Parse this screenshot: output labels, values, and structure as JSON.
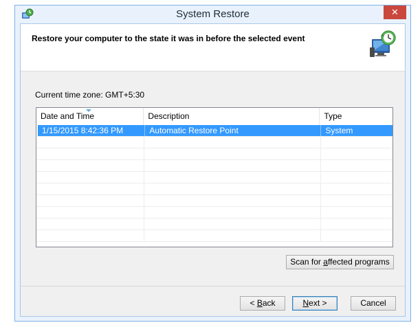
{
  "window": {
    "title": "System Restore",
    "close_glyph": "✕"
  },
  "header": {
    "text": "Restore your computer to the state it was in before the selected event",
    "icon": "system-restore-icon"
  },
  "timezone": {
    "label": "Current time zone: GMT+5:30"
  },
  "list": {
    "columns": [
      "Date and Time",
      "Description",
      "Type"
    ],
    "rows": [
      {
        "date": "1/15/2015 8:42:36 PM",
        "description": "Automatic Restore Point",
        "type": "System",
        "selected": true
      }
    ]
  },
  "buttons": {
    "scan_pre": "Scan for ",
    "scan_access": "a",
    "scan_post": "ffected programs",
    "back_pre": "< ",
    "back_access": "B",
    "back_post": "ack",
    "next_access": "N",
    "next_post": "ext >",
    "cancel": "Cancel"
  },
  "colors": {
    "selection": "#3399ff",
    "close_button": "#c9473d",
    "window_frame": "#7fb0e6"
  }
}
